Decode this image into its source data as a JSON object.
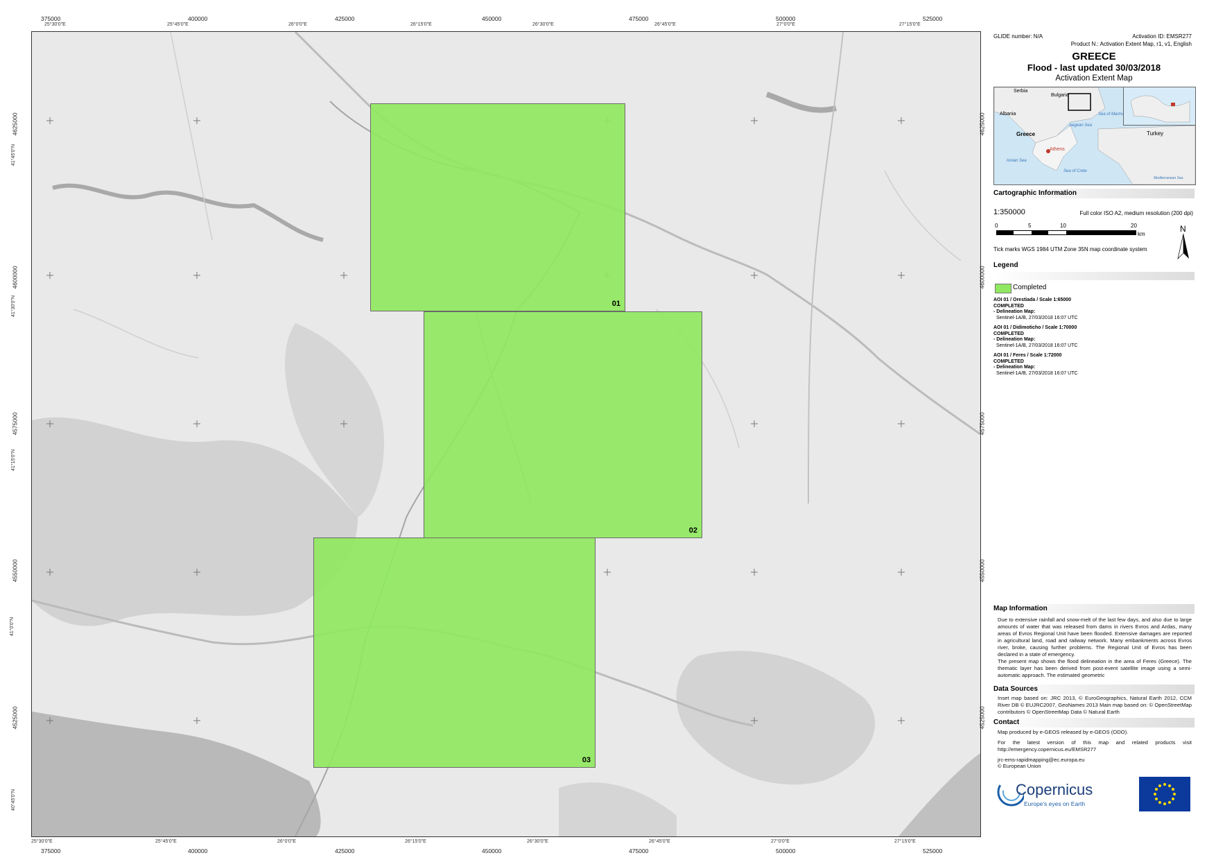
{
  "map": {
    "x_ticks_utm": [
      "375000",
      "400000",
      "425000",
      "450000",
      "475000",
      "500000",
      "525000"
    ],
    "x_ticks_geo_top": [
      "25°30'0\"E",
      "25°45'0\"E",
      "26°0'0\"E",
      "26°15'0\"E",
      "26°30'0\"E",
      "26°45'0\"E",
      "27°0'0\"E",
      "27°15'0\"E"
    ],
    "x_ticks_geo_bottom": [
      "25°30'0\"E",
      "25°45'0\"E",
      "26°0'0\"E",
      "26°15'0\"E",
      "26°30'0\"E",
      "26°45'0\"E",
      "27°0'0\"E",
      "27°15'0\"E"
    ],
    "y_ticks_utm": [
      "4625000",
      "4600000",
      "4575000",
      "4550000",
      "4525000"
    ],
    "y_ticks_geo": [
      "41°45'0\"N",
      "41°30'0\"N",
      "41°15'0\"N",
      "41°0'0\"N",
      "40°45'0\"N"
    ],
    "aois": [
      {
        "label": "01"
      },
      {
        "label": "02"
      },
      {
        "label": "03"
      }
    ]
  },
  "panel": {
    "glide": "GLIDE number: N/A",
    "activation_id": "Activation ID: EMSR277",
    "product": "Product N.: Activation Extent Map, r1, v1, English",
    "country": "GREECE",
    "event": "Flood - last updated 30/03/2018",
    "map_type": "Activation Extent Map",
    "inset_labels": {
      "serbia": "Serbia",
      "bulgaria": "Bulgaria",
      "albania": "Albania",
      "greece": "Greece",
      "athens": "Athens",
      "turkey": "Turkey",
      "aegean": "Aegean Sea",
      "ionian": "Ionian Sea",
      "crete": "Sea of Crete",
      "marmara": "Sea of Marmara",
      "med": "Mediterranean Sea"
    },
    "carto_title": "Cartographic Information",
    "scale": "1:350000",
    "print_info": "Full color ISO A2, medium resolution (200 dpi)",
    "scalebar_labels": [
      "0",
      "5",
      "10",
      "20"
    ],
    "scalebar_unit": "km",
    "north": "N",
    "grid_note": "Tick marks WGS 1984 UTM Zone 35N map coordinate system",
    "legend_title": "Legend",
    "legend_item": "Completed",
    "aoi_entries": [
      {
        "title": "AOI 01 / Orestiada / Scale 1:65000",
        "status": "COMPLETED",
        "delin": "- Delineation Map:",
        "source": "Sentinel-1A/B, 27/03/2018 16:07 UTC"
      },
      {
        "title": "AOI 01 / Didimoticho / Scale 1:70000",
        "status": "COMPLETED",
        "delin": "- Delineation Map:",
        "source": "Sentinel-1A/B, 27/03/2018 16:07 UTC"
      },
      {
        "title": "AOI 01 / Feres / Scale 1:72000",
        "status": "COMPLETED",
        "delin": "- Delineation Map:",
        "source": "Sentinel-1A/B, 27/03/2018 16:07 UTC"
      }
    ],
    "map_info_title": "Map Information",
    "map_info_p1": "Due to extensive rainfall and snow-melt of the last few days, and also due to large amounts of water that was released from dams in rivers Evros and Ardas, many areas of Evros Regional Unit have been flooded. Extensive damages are reported in agricultural land, road and railway network. Many embankments across Evros river, broke, causing further problems. The Regional Unit of Evros has been declared in a state of emergency.",
    "map_info_p2": "The present map shows the flood delineation in the area of Feres (Greece). The thematic layer has been derived from post-event satellite image using a semi-automatic approach. The estimated geometric",
    "data_sources_title": "Data Sources",
    "data_sources": "Inset map based on: JRC 2013, © EuroGeographics, Natural Earth 2012, CCM River DB © EUJRC2007, GeoNames 2013 Main map based on: © OpenStreetMap contributors © OpenStreetMap Data © Natural Earth",
    "contact_title": "Contact",
    "contact_1": "Map produced by e-GEOS released by e-GEOS (ODO).",
    "contact_2": "For the latest version of this map and related products visit http://emergency.copernicus.eu/EMSR277",
    "contact_3": "jrc-ems-rapidmapping@ec.europa.eu",
    "contact_4": "© European Union",
    "logo_main": "Copernicus",
    "logo_sub": "Europe's eyes on Earth"
  }
}
